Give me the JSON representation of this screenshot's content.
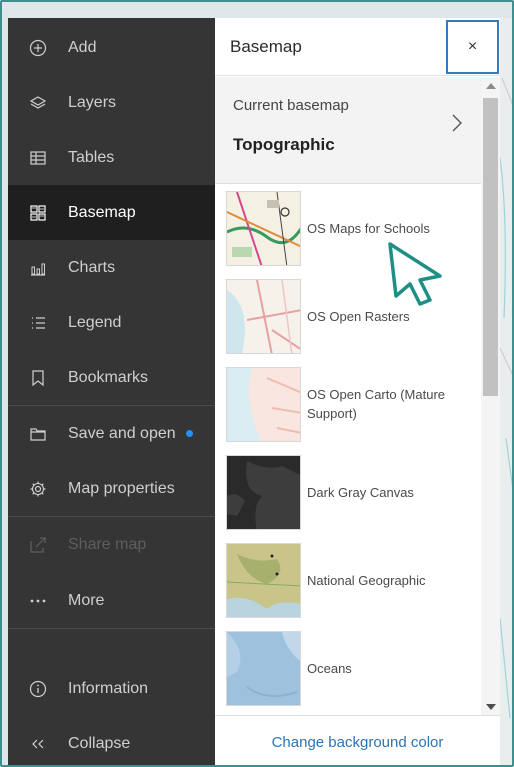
{
  "nav": {
    "items": [
      {
        "label": "Add",
        "icon": "plus-circle-icon"
      },
      {
        "label": "Layers",
        "icon": "layers-icon"
      },
      {
        "label": "Tables",
        "icon": "table-icon"
      },
      {
        "label": "Basemap",
        "icon": "basemap-icon",
        "active": true
      },
      {
        "label": "Charts",
        "icon": "chart-icon"
      },
      {
        "label": "Legend",
        "icon": "legend-icon"
      },
      {
        "label": "Bookmarks",
        "icon": "bookmark-icon"
      },
      {
        "label": "Save and open",
        "icon": "folder-icon",
        "has_indicator": true
      },
      {
        "label": "Map properties",
        "icon": "gear-icon"
      },
      {
        "label": "Share map",
        "icon": "share-icon",
        "disabled": true
      },
      {
        "label": "More",
        "icon": "more-icon"
      },
      {
        "label": "Information",
        "icon": "info-icon"
      },
      {
        "label": "Collapse",
        "icon": "collapse-icon"
      }
    ]
  },
  "panel": {
    "title": "Basemap",
    "close_label": "×",
    "current_label": "Current basemap",
    "current_value": "Topographic",
    "footer_link": "Change background color",
    "basemaps": [
      {
        "label": "OS Maps for Schools"
      },
      {
        "label": "OS Open Rasters"
      },
      {
        "label": "OS Open Carto (Mature Support)"
      },
      {
        "label": "Dark Gray Canvas"
      },
      {
        "label": "National Geographic"
      },
      {
        "label": "Oceans"
      }
    ]
  },
  "colors": {
    "accent": "#2b74b8",
    "nav_bg": "#353535",
    "nav_active": "#1f1f1f",
    "indicator": "#1e90ff",
    "cursor": "#1f8f86"
  }
}
